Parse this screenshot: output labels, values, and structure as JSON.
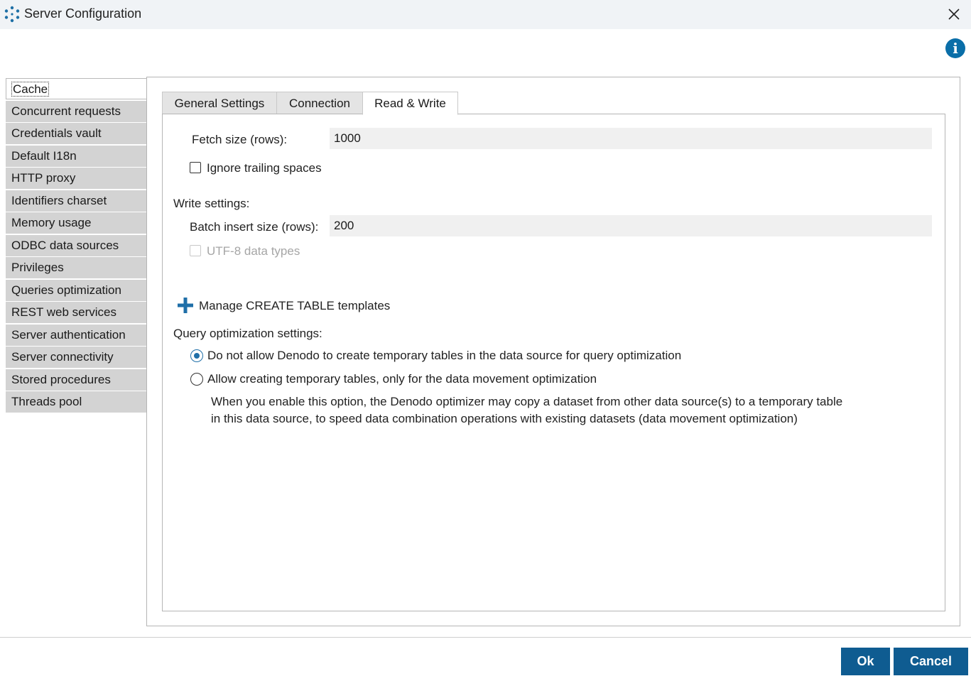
{
  "window": {
    "title": "Server Configuration",
    "close_icon": "close-icon",
    "info_label": "i"
  },
  "sidebar": {
    "items": [
      {
        "label": "Cache",
        "selected": true
      },
      {
        "label": "Concurrent requests"
      },
      {
        "label": "Credentials vault"
      },
      {
        "label": "Default I18n"
      },
      {
        "label": "HTTP proxy"
      },
      {
        "label": "Identifiers charset"
      },
      {
        "label": "Memory usage"
      },
      {
        "label": "ODBC data sources"
      },
      {
        "label": "Privileges"
      },
      {
        "label": "Queries optimization"
      },
      {
        "label": "REST web services"
      },
      {
        "label": "Server authentication"
      },
      {
        "label": "Server connectivity"
      },
      {
        "label": "Stored procedures"
      },
      {
        "label": "Threads pool"
      }
    ]
  },
  "tabs": [
    {
      "label": "General Settings"
    },
    {
      "label": "Connection"
    },
    {
      "label": "Read & Write",
      "active": true
    }
  ],
  "read_write": {
    "fetch_size_label": "Fetch size (rows):",
    "fetch_size_value": "1000",
    "ignore_trailing_label": "Ignore trailing spaces",
    "ignore_trailing_checked": false,
    "write_settings_label": "Write settings:",
    "batch_insert_label": "Batch insert size (rows):",
    "batch_insert_value": "200",
    "utf8_label": "UTF-8 data types",
    "utf8_checked": false,
    "manage_templates_label": "Manage CREATE TABLE templates",
    "query_opt_label": "Query optimization settings:",
    "radio_options": [
      {
        "label": "Do not allow Denodo to create temporary tables in the data source for query optimization",
        "checked": true
      },
      {
        "label": "Allow creating temporary tables, only for the data movement optimization",
        "checked": false
      }
    ],
    "description_line1": "When you enable this option, the Denodo optimizer may copy a dataset from other data source(s) to a temporary table",
    "description_line2": "in this data source, to speed data combination operations with existing datasets (data movement optimization)"
  },
  "footer": {
    "ok_label": "Ok",
    "cancel_label": "Cancel"
  },
  "colors": {
    "accent": "#0f5c91",
    "info": "#0a6ea8",
    "sidebar_bg": "#d3d3d3",
    "field_bg": "#f0f0f0"
  }
}
